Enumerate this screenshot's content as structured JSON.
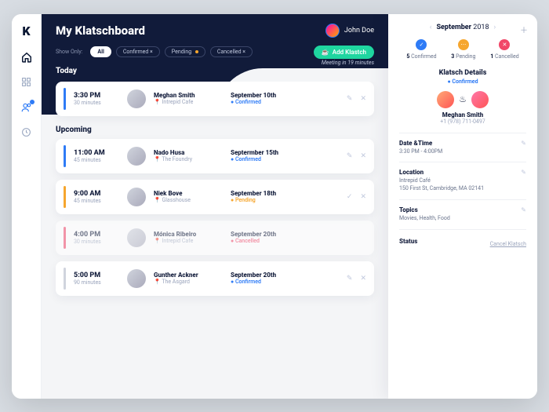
{
  "header": {
    "title": "My Klatschboard",
    "user": "John Doe"
  },
  "filters": {
    "label": "Show Only:",
    "all": "All",
    "confirmed": "Confirmed ×",
    "pending": "Pending ",
    "cancelled": "Cancelled ×"
  },
  "add_btn": "Add Klastch",
  "today_label": "Today",
  "meeting_in": "Meeting in 19 minutes",
  "upcoming_label": "Upcoming",
  "colors": {
    "blue": "#2e7bf6",
    "orange": "#f6a62e",
    "red": "#f14668",
    "gray": "#d0d4dd"
  },
  "today": [
    {
      "time": "3:30 PM",
      "dur": "30 minutes",
      "name": "Meghan Smith",
      "loc": "Intrepid Cafe",
      "date": "September 10th",
      "status": "Confirmed",
      "scolor": "#2e7bf6",
      "bar": "#2e7bf6",
      "act": "edit"
    }
  ],
  "upcoming": [
    {
      "time": "11:00 AM",
      "dur": "45 minutes",
      "name": "Nado Husa",
      "loc": "The Foundry",
      "date": "Septermber 15th",
      "status": "Confirmed",
      "scolor": "#2e7bf6",
      "bar": "#2e7bf6",
      "act": "edit"
    },
    {
      "time": "9:00 AM",
      "dur": "45 minutes",
      "name": "Niek Bove",
      "loc": "Glasshouse",
      "date": "September 18th",
      "status": "Pending",
      "scolor": "#f6a62e",
      "bar": "#f6a62e",
      "act": "check"
    },
    {
      "time": "4:00 PM",
      "dur": "30 minutes",
      "name": "Mónica Ribeiro",
      "loc": "Intrepid Cafe",
      "date": "September 20th",
      "status": "Cancelled",
      "scolor": "#f14668",
      "bar": "#f14668",
      "act": "none"
    },
    {
      "time": "5:00 PM",
      "dur": "90 minutes",
      "name": "Gunther Ackner",
      "loc": "The Asgard",
      "date": "September 20th",
      "status": "Confirmed",
      "scolor": "#2e7bf6",
      "bar": "#d0d4dd",
      "act": "edit"
    }
  ],
  "side": {
    "month": "September",
    "year": "2018",
    "stats": [
      {
        "n": "5",
        "l": "Confirmed",
        "c": "#2e7bf6",
        "i": "✓"
      },
      {
        "n": "3",
        "l": "Pending",
        "c": "#f6a62e",
        "i": "⋯"
      },
      {
        "n": "1",
        "l": "Cancelled",
        "c": "#f14668",
        "i": "✕"
      }
    ],
    "details_title": "Klatsch Details",
    "details_status": "● Confirmed",
    "person": "Meghan Smith",
    "phone": "+1 (978) 711-0497",
    "rows": [
      {
        "k": "Date &Time",
        "v": "3:30 PM - 4:00PM"
      },
      {
        "k": "Location",
        "v": "Intrepid Café\n150 First St, Cambridge, MA 02141"
      },
      {
        "k": "Topics",
        "v": "Movies, Health, Food"
      }
    ],
    "status_label": "Status",
    "cancel": "Cancel Klatsch"
  }
}
